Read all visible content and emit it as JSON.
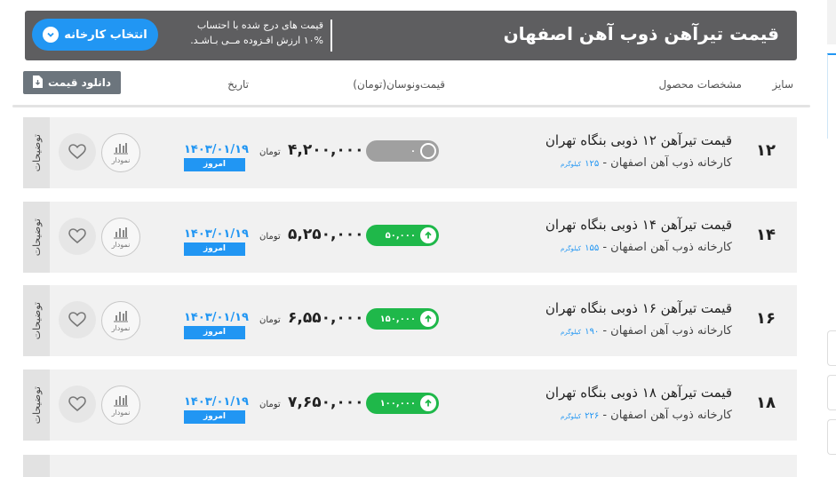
{
  "header": {
    "title": "قیمت تیرآهن ذوب آهن اصفهان",
    "note_line1": "قیمت های درج شده با احتساب",
    "note_line2": "۱۰% ارزش افـزوده مــی بـاشـد.",
    "factory_button": "انتخاب کارخانه"
  },
  "table_head": {
    "size": "سایز",
    "spec": "مشخصات محصول",
    "price_change": "قیمت‌ونوسان(تومان)",
    "date": "تاریخ",
    "download": "دانلود قیمت"
  },
  "rows": [
    {
      "size": "۱۲",
      "name": "قیمت تیرآهن ۱۲ ذوبی بنگاه تهران",
      "factory": "کارخانه ذوب آهن اصفهان -",
      "weight": "۱۲۵",
      "weight_unit": "کیلوگرم",
      "change": "۰",
      "change_dir": "zero",
      "price": "۴,۲۰۰,۰۰۰",
      "currency": "تومان",
      "date": "۱۴۰۳/۰۱/۱۹",
      "today": "امروز",
      "chart": "نمودار",
      "desc": "توضیحات"
    },
    {
      "size": "۱۴",
      "name": "قیمت تیرآهن ۱۴ ذوبی بنگاه تهران",
      "factory": "کارخانه ذوب آهن اصفهان -",
      "weight": "۱۵۵",
      "weight_unit": "کیلوگرم",
      "change": "۵۰,۰۰۰",
      "change_dir": "up",
      "price": "۵,۲۵۰,۰۰۰",
      "currency": "تومان",
      "date": "۱۴۰۳/۰۱/۱۹",
      "today": "امروز",
      "chart": "نمودار",
      "desc": "توضیحات"
    },
    {
      "size": "۱۶",
      "name": "قیمت تیرآهن ۱۶ ذوبی بنگاه تهران",
      "factory": "کارخانه ذوب آهن اصفهان -",
      "weight": "۱۹۰",
      "weight_unit": "کیلوگرم",
      "change": "۱۵۰,۰۰۰",
      "change_dir": "up",
      "price": "۶,۵۵۰,۰۰۰",
      "currency": "تومان",
      "date": "۱۴۰۳/۰۱/۱۹",
      "today": "امروز",
      "chart": "نمودار",
      "desc": "توضیحات"
    },
    {
      "size": "۱۸",
      "name": "قیمت تیرآهن ۱۸ ذوبی بنگاه تهران",
      "factory": "کارخانه ذوب آهن اصفهان -",
      "weight": "۲۲۶",
      "weight_unit": "کیلوگرم",
      "change": "۱۰۰,۰۰۰",
      "change_dir": "up",
      "price": "۷,۶۵۰,۰۰۰",
      "currency": "تومان",
      "date": "۱۴۰۳/۰۱/۱۹",
      "today": "امروز",
      "chart": "نمودار",
      "desc": "توضیحات"
    }
  ],
  "colors": {
    "header_bg": "#5e5e60",
    "accent_blue": "#2196f3",
    "up_green": "#1fb84a",
    "neutral_gray": "#a0a0a0"
  }
}
